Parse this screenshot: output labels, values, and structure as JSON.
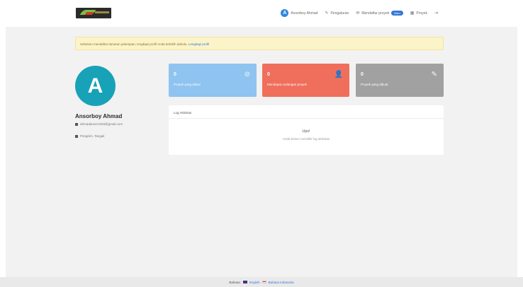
{
  "navbar": {
    "profile_initial": "A",
    "profile_name": "Ansorboy Ahmad",
    "settings_label": "Pengaturan",
    "messages_label": "Mendaftar proyek",
    "messages_badge": "Baru",
    "projects_label": "Proyek",
    "logout_icon": "sign-out-icon"
  },
  "alert": {
    "text": "Sebelum mendaftar lamaran pekerjaan, lengkapi profil Anda terlebih dahulu.",
    "link": "Lengkapi profil"
  },
  "profile": {
    "initial": "A",
    "name": "Ansorboy Ahmad",
    "email": "ahmadansor1203@gmail.com",
    "location": "Pengirim, Tangali"
  },
  "cards": [
    {
      "value": "0",
      "label": "Proyek yang diikuti",
      "icon": "check-circle-icon",
      "color": "#8fc3f0"
    },
    {
      "value": "0",
      "label": "Mendapat undangan proyek",
      "icon": "user-add-icon",
      "color": "#ef6f5c"
    },
    {
      "value": "0",
      "label": "Proyek yang dibuat",
      "icon": "edit-icon",
      "color": "#a1a1a1"
    }
  ],
  "activity": {
    "header": "Log Aktivitas",
    "empty_title": "Ups!",
    "empty_message": "Anda belum memiliki log aktivitas"
  },
  "footer": {
    "label": "Bahasa:",
    "lang_en": "English",
    "lang_id": "Bahasa Indonesia"
  }
}
